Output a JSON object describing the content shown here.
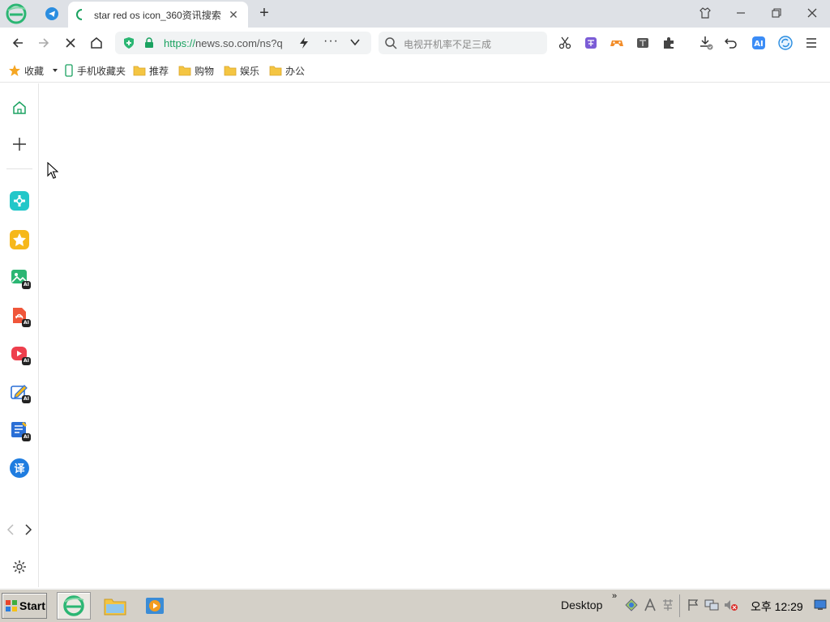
{
  "tab_bar": {
    "active_tab_title": "star red os icon_360资讯搜索",
    "close_symbol": "✕",
    "new_tab_symbol": "+"
  },
  "nav": {
    "url_scheme": "https://",
    "url_rest": "news.so.com/ns?q",
    "more_symbol": "···",
    "search_placeholder": "电视开机率不足三成"
  },
  "bookmarks": {
    "favorites_label": "收藏",
    "items": [
      "手机收藏夹",
      "推荐",
      "购物",
      "娱乐",
      "办公"
    ]
  },
  "sidebar": {
    "items": [
      "home-icon",
      "add-icon",
      "health-icon",
      "favorites-star-icon",
      "ai-image-icon",
      "ai-pdf-icon",
      "ai-video-icon",
      "ai-write-icon",
      "ai-doc-icon",
      "translate-icon"
    ],
    "translate_glyph": "译",
    "ai_badge": "AI"
  },
  "taskbar": {
    "start_label": "Start",
    "desktop_label": "Desktop",
    "chevron": "»",
    "clock": "오후 12:29"
  },
  "colors": {
    "accent_green": "#1aa260",
    "tabbar_bg": "#dee1e6",
    "taskbar_bg": "#d4d0c8"
  }
}
